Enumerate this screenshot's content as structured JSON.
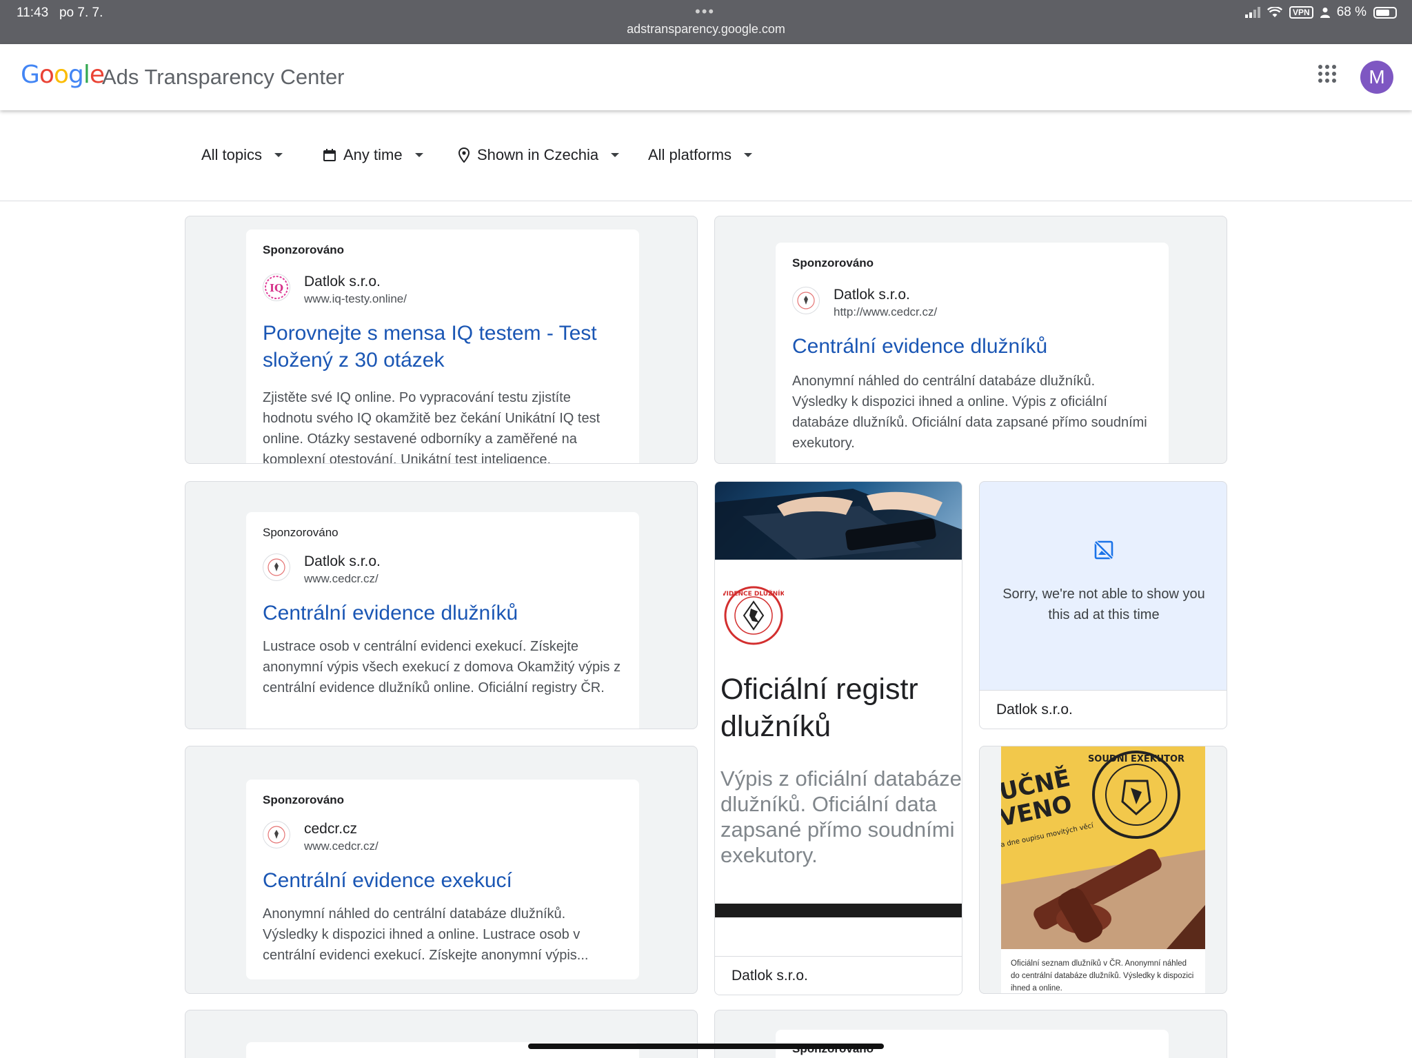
{
  "status_bar": {
    "time": "11:43",
    "date": "po 7. 7.",
    "url": "adstransparency.google.com",
    "vpn": "VPN",
    "battery": "68 %"
  },
  "header": {
    "logo_text": "Google",
    "title": "Ads Transparency Center",
    "avatar_letter": "M"
  },
  "filters": {
    "topics": "All topics",
    "time": "Any time",
    "region": "Shown in Czechia",
    "platforms": "All platforms"
  },
  "ads": [
    {
      "sponsored": "Sponzorováno",
      "advertiser": "Datlok s.r.o.",
      "url": "www.iq-testy.online/",
      "headline": "Porovnejte s mensa IQ testem - Test složený z 30 otázek",
      "description": "Zjistěte své IQ online. Po vypracování testu zjistíte hodnotu svého IQ okamžitě bez čekání Unikátní IQ test online. Otázky sestavené odborníky a zaměřené na komplexní otestování. Unikátní test inteligence."
    },
    {
      "sponsored": "Sponzorováno",
      "advertiser": "Datlok s.r.o.",
      "url": "http://www.cedcr.cz/",
      "headline": "Centrální evidence dlužníků",
      "description": "Anonymní náhled do centrální databáze dlužníků. Výsledky k dispozici ihned a online. Výpis z oficiální databáze dlužníků. Oficiální data zapsané přímo soudními exekutory."
    },
    {
      "sponsored": "Sponzorováno",
      "advertiser": "Datlok s.r.o.",
      "url": "www.cedcr.cz/",
      "headline": "Centrální evidence dlužníků",
      "description": "Lustrace osob v centrální evidenci exekucí. Získejte anonymní výpis všech exekucí z domova Okamžitý výpis z centrální evidence dlužníků online. Oficiální registry ČR."
    },
    {
      "sponsored": "Sponzorováno",
      "advertiser": "cedcr.cz",
      "url": "www.cedcr.cz/",
      "headline": "Centrální evidence exekucí",
      "description": "Anonymní náhled do centrální databáze dlužníků. Výsledky k dispozici ihned a online. Lustrace osob v centrální evidenci exekucí. Získejte anonymní výpis..."
    }
  ],
  "image_ad": {
    "seal_text": "EVIDENCE DLUŽNÍKŮ",
    "title": "Oficiální registr dlužníků",
    "body": "Výpis z oficiální databáze dlužníků. Oficiální data zapsané přímo soudními exekutory.",
    "advertiser": "Datlok s.r.o."
  },
  "unavailable_ad": {
    "message": "Sorry, we're not able to show you this ad at this time",
    "advertiser": "Datlok s.r.o."
  },
  "photo_ad": {
    "sign_line1": "UČNĚ",
    "sign_line2": "VENO",
    "sign_small": "a dne\noupisu movitých věcí",
    "seal_text": "SOUDNÍ EXEKUTOR",
    "caption": "Oficiální seznam dlužníků v ČR. Anonymní náhled do centrální databáze dlužníků. Výsledky k dispozici ihned a online."
  },
  "bottom_row": {
    "sponsored": "Sponzorováno"
  }
}
